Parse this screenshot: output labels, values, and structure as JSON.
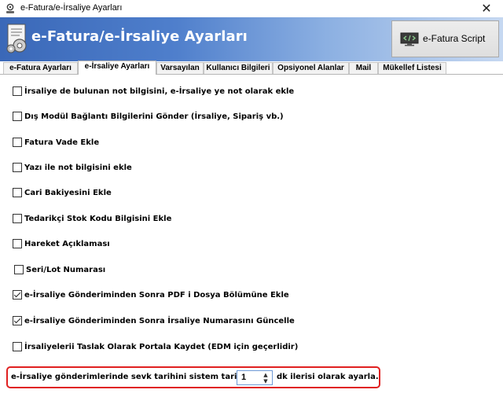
{
  "window": {
    "title": "e-Fatura/e-İrsaliye Ayarları",
    "close_glyph": "✕"
  },
  "banner": {
    "title": "e-Fatura/e-İrsaliye Ayarları",
    "icon": "settings-document-icon"
  },
  "script_button": {
    "label": "e-Fatura Script",
    "icon": "code-monitor-icon"
  },
  "tabs": [
    {
      "label": "e-Fatura Ayarları",
      "active": false
    },
    {
      "label": "e-İrsaliye Ayarları",
      "active": true
    },
    {
      "label": "Varsayılan",
      "active": false
    },
    {
      "label": "Kullanıcı Bilgileri",
      "active": false
    },
    {
      "label": "Opsiyonel Alanlar",
      "active": false
    },
    {
      "label": "Mail",
      "active": false
    },
    {
      "label": "Mükellef Listesi",
      "active": false
    }
  ],
  "options": [
    {
      "label": "İrsaliye de bulunan not bilgisini, e-İrsaliye ye not olarak ekle",
      "checked": false
    },
    {
      "label": "Dış Modül Bağlantı Bilgilerini Gönder (İrsaliye, Sipariş vb.)",
      "checked": false
    },
    {
      "label": "Fatura Vade Ekle",
      "checked": false
    },
    {
      "label": "Yazı ile not bilgisini ekle",
      "checked": false
    },
    {
      "label": "Cari Bakiyesini Ekle",
      "checked": false
    },
    {
      "label": "Tedarikçi Stok Kodu Bilgisini Ekle",
      "checked": false
    },
    {
      "label": "Hareket Açıklaması",
      "checked": false
    },
    {
      "label": "Seri/Lot Numarası",
      "checked": false
    },
    {
      "label": "e-İrsaliye Gönderiminden Sonra PDF i Dosya Bölümüne Ekle",
      "checked": true
    },
    {
      "label": "e-İrsaliye Gönderiminden Sonra İrsaliye Numarasını Güncelle",
      "checked": true
    },
    {
      "label": "İrsaliyelerii Taslak Olarak Portala Kaydet (EDM için geçerlidir)",
      "checked": false
    }
  ],
  "sevk": {
    "label_before": "e-İrsaliye gönderimlerinde sevk tarihini sistem tarihinin",
    "value": "1",
    "label_after": "dk ilerisi olarak ayarla.",
    "highlight_color": "#e02020"
  },
  "colors": {
    "banner_start": "#3a68b8",
    "banner_end": "#c6d8f1"
  }
}
